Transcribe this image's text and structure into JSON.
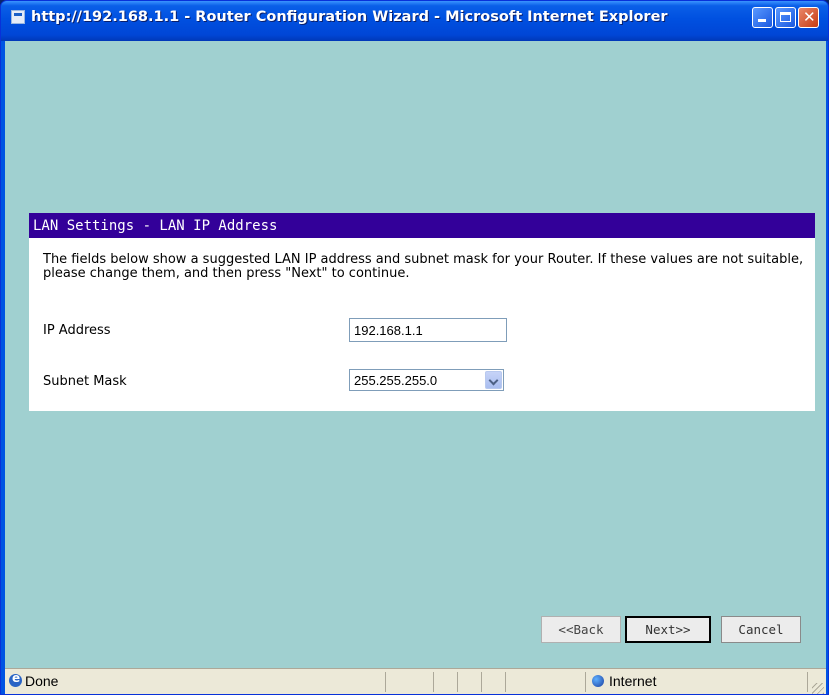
{
  "window": {
    "title": "http://192.168.1.1 - Router Configuration Wizard - Microsoft Internet Explorer",
    "icon": "ie-page-icon",
    "controls": [
      "minimize-icon",
      "maximize-icon",
      "close-icon"
    ]
  },
  "panel": {
    "header": "LAN Settings - LAN IP Address",
    "description": "The fields below show a suggested LAN IP address and subnet mask for your Router. If these values are not suitable, please change them, and then press \"Next\" to continue.",
    "ip_label": "IP Address",
    "ip_value": "192.168.1.1",
    "subnet_label": "Subnet Mask",
    "subnet_value": "255.255.255.0"
  },
  "buttons": {
    "back": "<<Back",
    "next": "Next>>",
    "cancel": "Cancel"
  },
  "statusbar": {
    "status": "Done",
    "zone": "Internet"
  },
  "colors": {
    "page_background": "#a0d0d0",
    "panel_header": "#330099",
    "titlebar": "#0054e3"
  }
}
